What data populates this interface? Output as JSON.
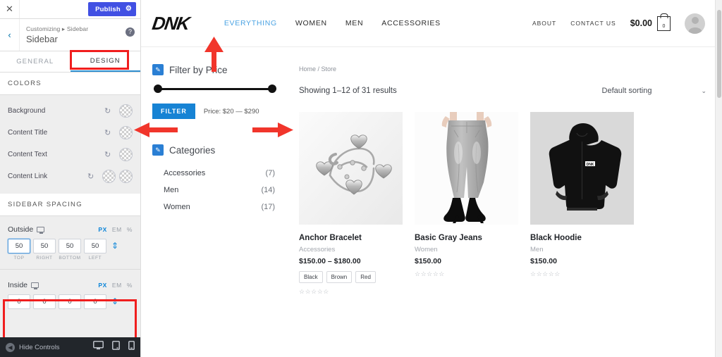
{
  "customizer": {
    "close_label": "✕",
    "publish_label": "Publish",
    "gear_icon": "⚙",
    "back_icon": "‹",
    "breadcrumb": "Customizing ▸ Sidebar",
    "panel_title": "Sidebar",
    "help_icon": "?",
    "tabs": [
      {
        "label": "GENERAL",
        "active": false
      },
      {
        "label": "DESIGN",
        "active": true
      }
    ],
    "colors_section": {
      "heading": "COLORS",
      "rows": [
        {
          "label": "Background",
          "swatches": 1
        },
        {
          "label": "Content Title",
          "swatches": 1
        },
        {
          "label": "Content Text",
          "swatches": 1
        },
        {
          "label": "Content Link",
          "swatches": 2
        }
      ]
    },
    "spacing_section": {
      "heading": "SIDEBAR SPACING",
      "outside": {
        "label": "Outside",
        "units": [
          "PX",
          "EM",
          "%"
        ],
        "active_unit": "PX",
        "values": [
          "50",
          "50",
          "50",
          "50"
        ],
        "captions": [
          "TOP",
          "RIGHT",
          "BOTTOM",
          "LEFT"
        ],
        "link_icon": "⇕"
      },
      "inside": {
        "label": "Inside",
        "units": [
          "PX",
          "EM",
          "%"
        ],
        "active_unit": "PX",
        "values": [
          "0",
          "0",
          "0",
          "0"
        ],
        "captions": [
          "",
          "",
          "",
          ""
        ],
        "link_icon": "⇕"
      }
    },
    "footer": {
      "hide_controls": "Hide Controls",
      "hide_icon": "◀",
      "devices": [
        {
          "name": "desktop",
          "glyph": "🖵",
          "active": true
        },
        {
          "name": "tablet",
          "glyph": "▯",
          "active": false
        },
        {
          "name": "mobile",
          "glyph": "▯",
          "active": false
        }
      ]
    }
  },
  "site": {
    "logo": "DNK",
    "nav": [
      {
        "label": "EVERYTHING",
        "active": true
      },
      {
        "label": "WOMEN",
        "active": false
      },
      {
        "label": "MEN",
        "active": false
      },
      {
        "label": "ACCESSORIES",
        "active": false
      }
    ],
    "right_nav": [
      {
        "label": "ABOUT"
      },
      {
        "label": "CONTACT US"
      }
    ],
    "cart": {
      "total": "$0.00",
      "count": "0"
    },
    "sidebar": {
      "price_widget": {
        "title": "Filter by Price",
        "filter_button": "FILTER",
        "price_label": "Price: $20 — $290",
        "min": "$20",
        "max": "$290"
      },
      "categories_widget": {
        "title": "Categories",
        "items": [
          {
            "label": "Accessories",
            "count": "(7)"
          },
          {
            "label": "Men",
            "count": "(14)"
          },
          {
            "label": "Women",
            "count": "(17)"
          }
        ]
      }
    },
    "shop": {
      "breadcrumb": "Home / Store",
      "results": "Showing 1–12 of 31 results",
      "sort_value": "Default sorting",
      "chevron": "⌄",
      "products": [
        {
          "name": "Anchor Bracelet",
          "category": "Accessories",
          "price": "$150.00 – $180.00",
          "variants": [
            "Black",
            "Brown",
            "Red"
          ],
          "rating": "☆☆☆☆☆",
          "image": "silver-charm-bracelet"
        },
        {
          "name": "Basic Gray Jeans",
          "category": "Women",
          "price": "$150.00",
          "variants": [],
          "rating": "☆☆☆☆☆",
          "image": "gray-jeans-model"
        },
        {
          "name": "Black Hoodie",
          "category": "Men",
          "price": "$150.00",
          "variants": [],
          "rating": "☆☆☆☆☆",
          "image": "black-zip-hoodie"
        }
      ]
    }
  },
  "annotations": {
    "accent_color": "#f01e1e",
    "arrows": [
      "up-arrow-to-nav",
      "left-arrow-sidebar-edge",
      "right-arrow-sidebar-edge"
    ],
    "boxes": [
      "design-tab-box",
      "outside-spacing-box"
    ]
  }
}
